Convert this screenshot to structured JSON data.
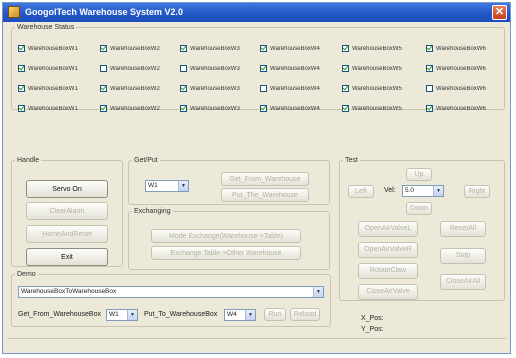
{
  "window": {
    "title": "GoogolTech Warehouse System  V2.0",
    "close_symbol": "✕"
  },
  "status": {
    "title": "Warehouse Status",
    "rows": [
      [
        {
          "label": "WarehouseBoxW1",
          "checked": true
        },
        {
          "label": "WarehouseBoxW2",
          "checked": false
        },
        {
          "label": "WarehouseBoxW3",
          "checked": false
        },
        {
          "label": "WarehouseBoxW4",
          "checked": true
        },
        {
          "label": "WarehouseBoxW5",
          "checked": true
        },
        {
          "label": "WarehouseBoxW6",
          "checked": true
        }
      ],
      [
        {
          "label": "WarehouseBoxW1",
          "checked": true
        },
        {
          "label": "WarehouseBoxW2",
          "checked": true
        },
        {
          "label": "WarehouseBoxW3",
          "checked": true
        },
        {
          "label": "WarehouseBoxW4",
          "checked": false
        },
        {
          "label": "WarehouseBoxW5",
          "checked": true
        },
        {
          "label": "WarehouseBoxW6",
          "checked": false
        }
      ],
      [
        {
          "label": "WarehouseBoxW1",
          "checked": true
        },
        {
          "label": "WarehouseBoxW2",
          "checked": true
        },
        {
          "label": "WarehouseBoxW3",
          "checked": true
        },
        {
          "label": "WarehouseBoxW4",
          "checked": true
        },
        {
          "label": "WarehouseBoxW5",
          "checked": true
        },
        {
          "label": "WarehouseBoxW6",
          "checked": true
        }
      ]
    ],
    "row1": [
      "WarehouseBoxW1",
      "WarehouseBoxW2",
      "WarehouseBoxW3",
      "WarehouseBoxW4",
      "WarehouseBoxW5",
      "WarehouseBoxW6"
    ]
  },
  "handle": {
    "title": "Handle",
    "buttons": [
      {
        "label": "Servo On",
        "enabled": true
      },
      {
        "label": "ClearAlarm",
        "enabled": false
      },
      {
        "label": "HomeAndReset",
        "enabled": false
      },
      {
        "label": "Exit",
        "enabled": true
      }
    ]
  },
  "getput": {
    "title": "Get/Put",
    "combo_value": "W1",
    "buttons": [
      "Get_From_Warehouse",
      "Put_The_Warehouse"
    ]
  },
  "exchanging": {
    "title": "Exchanging",
    "buttons": [
      "Mode Exchange(Warehouse->Table)",
      "Exchange Table->Other Warehouse"
    ]
  },
  "test": {
    "title": "Test",
    "nudge": [
      "Up",
      "Left",
      "Right",
      "Down"
    ],
    "vel_label": "Vel:",
    "vel_value": "5.0",
    "buttons": [
      "OpenAirValveL",
      "OpenAirValveR",
      "RotateClaw",
      "CloseAirValve",
      "ResetAll",
      "CloseAirAll",
      "Stop"
    ]
  },
  "demo": {
    "title": "Demo",
    "combo_value": "WarehouseBoxToWarehouseBox",
    "get_label": "Get_From_WarehouseBox",
    "get_value": "W1",
    "put_label": "Put_To_WarehouseBox",
    "put_value": "W4",
    "run_label": "Run",
    "reload_label": "Reload",
    "xpos": "X_Pos:",
    "ypos": "Y_Pos:"
  },
  "colors": {
    "window_bg": "#ece9d8",
    "title_blue": "#2357c8",
    "check_green": "#21a121"
  },
  "icons": [
    "app-icon",
    "close-icon",
    "checkbox-icon",
    "combo-arrow-icon"
  ]
}
